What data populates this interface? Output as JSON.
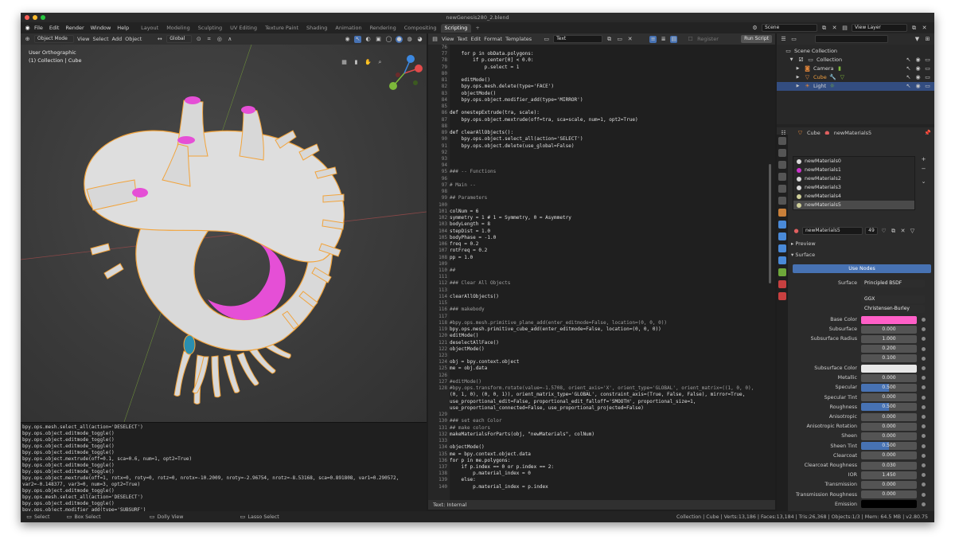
{
  "window_title": "newGenesis280_2.blend",
  "menu": [
    "File",
    "Edit",
    "Render",
    "Window",
    "Help"
  ],
  "workspaces": [
    "Layout",
    "Modeling",
    "Sculpting",
    "UV Editing",
    "Texture Paint",
    "Shading",
    "Animation",
    "Rendering",
    "Compositing",
    "Scripting",
    "+"
  ],
  "active_workspace": "Scripting",
  "scene": "Scene",
  "view_layer": "View Layer",
  "viewport_header": {
    "mode": "Object Mode",
    "items": [
      "View",
      "Select",
      "Add",
      "Object"
    ],
    "transform": "Global"
  },
  "viewport": {
    "label1": "User Orthographic",
    "label2": "(1) Collection | Cube"
  },
  "text_header": {
    "items": [
      "View",
      "Text",
      "Edit",
      "Format",
      "Templates"
    ],
    "datablock": "Text",
    "register": "Register",
    "run": "Run Script"
  },
  "code_lines": [
    {
      "n": "76",
      "t": ""
    },
    {
      "n": "77",
      "t": "    for p in obData.polygons:"
    },
    {
      "n": "78",
      "t": "        if p.center[0] < 0.0:"
    },
    {
      "n": "79",
      "t": "            p.select = 1"
    },
    {
      "n": "80",
      "t": ""
    },
    {
      "n": "81",
      "t": "    editMode()"
    },
    {
      "n": "82",
      "t": "    bpy.ops.mesh.delete(type='FACE')"
    },
    {
      "n": "83",
      "t": "    objectMode()"
    },
    {
      "n": "84",
      "t": "    bpy.ops.object.modifier_add(type='MIRROR')"
    },
    {
      "n": "85",
      "t": ""
    },
    {
      "n": "86",
      "t": "def onestepExtrude(tra, scale):"
    },
    {
      "n": "87",
      "t": "    bpy.ops.object.mextrude(off=tra, sca=scale, num=1, opt2=True)"
    },
    {
      "n": "88",
      "t": ""
    },
    {
      "n": "89",
      "t": "def clearAllObjects():"
    },
    {
      "n": "90",
      "t": "    bpy.ops.object.select_all(action='SELECT')"
    },
    {
      "n": "91",
      "t": "    bpy.ops.object.delete(use_global=False)"
    },
    {
      "n": "92",
      "t": ""
    },
    {
      "n": "93",
      "t": ""
    },
    {
      "n": "94",
      "t": ""
    },
    {
      "n": "95",
      "t": "### -- Functions"
    },
    {
      "n": "96",
      "t": ""
    },
    {
      "n": "97",
      "t": "# Main --"
    },
    {
      "n": "98",
      "t": ""
    },
    {
      "n": "99",
      "t": "## Parameters"
    },
    {
      "n": "100",
      "t": ""
    },
    {
      "n": "101",
      "t": "colNum = 6"
    },
    {
      "n": "102",
      "t": "symmetry = 1 # 1 = Symmetry, 0 = Asymmetry"
    },
    {
      "n": "103",
      "t": "bodyLength = 8"
    },
    {
      "n": "104",
      "t": "stepDist = 1.0"
    },
    {
      "n": "105",
      "t": "bodyPhase = -1.0"
    },
    {
      "n": "106",
      "t": "freq = 0.2"
    },
    {
      "n": "107",
      "t": "rotFreq = 0.2"
    },
    {
      "n": "108",
      "t": "pp = 1.0"
    },
    {
      "n": "109",
      "t": ""
    },
    {
      "n": "110",
      "t": "##"
    },
    {
      "n": "111",
      "t": ""
    },
    {
      "n": "112",
      "t": "### Clear All Objects"
    },
    {
      "n": "113",
      "t": ""
    },
    {
      "n": "114",
      "t": "clearAllObjects()"
    },
    {
      "n": "115",
      "t": ""
    },
    {
      "n": "116",
      "t": "### makebody"
    },
    {
      "n": "117",
      "t": ""
    },
    {
      "n": "118",
      "t": "#bpy.ops.mesh.primitive_plane_add(enter_editmode=False, location=(0, 0, 0))"
    },
    {
      "n": "119",
      "t": "bpy.ops.mesh.primitive_cube_add(enter_editmode=False, location=(0, 0, 0))"
    },
    {
      "n": "120",
      "t": "editMode()"
    },
    {
      "n": "121",
      "t": "deselectAllFace()"
    },
    {
      "n": "122",
      "t": "objectMode()"
    },
    {
      "n": "123",
      "t": ""
    },
    {
      "n": "124",
      "t": "obj = bpy.context.object"
    },
    {
      "n": "125",
      "t": "me = obj.data"
    },
    {
      "n": "126",
      "t": ""
    },
    {
      "n": "127",
      "t": "#editMode()"
    },
    {
      "n": "128",
      "t": "#bpy.ops.transform.rotate(value=-1.5708, orient_axis='X', orient_type='GLOBAL', orient_matrix=((1, 0, 0),"
    },
    {
      "n": "",
      "t": "(0, 1, 0), (0, 0, 1)), orient_matrix_type='GLOBAL', constraint_axis=(True, False, False), mirror=True,"
    },
    {
      "n": "",
      "t": "use_proportional_edit=False, proportional_edit_falloff='SMOOTH', proportional_size=1,"
    },
    {
      "n": "",
      "t": "use_proportional_connected=False, use_proportional_projected=False)"
    },
    {
      "n": "129",
      "t": ""
    },
    {
      "n": "130",
      "t": "### set each Color"
    },
    {
      "n": "131",
      "t": "## make colors"
    },
    {
      "n": "132",
      "t": "makeMaterialsForParts(obj, \"newMaterials\", colNum)"
    },
    {
      "n": "133",
      "t": ""
    },
    {
      "n": "134",
      "t": "objectMode()"
    },
    {
      "n": "135",
      "t": "me = bpy.context.object.data"
    },
    {
      "n": "136",
      "t": "for p in me.polygons:"
    },
    {
      "n": "137",
      "t": "    if p.index == 0 or p.index == 2:"
    },
    {
      "n": "138",
      "t": "        p.material_index = 0"
    },
    {
      "n": "139",
      "t": "    else:"
    },
    {
      "n": "140",
      "t": "        p.material_index = p.index"
    }
  ],
  "text_footer": "Text: Internal",
  "console_lines": [
    "bpy.ops.mesh.select_all(action='DESELECT')",
    "bpy.ops.object.editmode_toggle()",
    "bpy.ops.object.editmode_toggle()",
    "bpy.ops.object.editmode_toggle()",
    "bpy.ops.object.editmode_toggle()",
    "bpy.ops.object.mextrude(off=0.1, sca=0.6, num=1, opt2=True)",
    "bpy.ops.object.editmode_toggle()",
    "bpy.ops.object.editmode_toggle()",
    "bpy.ops.object.mextrude(off=1, rotx=0, roty=0, rotz=0, nrotx=-10.2009, nroty=-2.96754, nrotz=-8.53168, sca=0.891808, var1=0.290572,",
    "var2=-0.148377, var3=0, num=3, opt2=True)",
    "bpy.ops.object.editmode_toggle()",
    "bpy.ops.mesh.select_all(action='DESELECT')",
    "bpy.ops.object.editmode_toggle()",
    "bpy.ops.object.modifier_add(type='SUBSURF')",
    "bpy.ops.text.run_script()"
  ],
  "outliner": {
    "root": "Scene Collection",
    "collection": "Collection",
    "items": [
      "Camera",
      "Cube",
      "Light"
    ]
  },
  "props_header": {
    "object": "Cube",
    "material": "newMaterials5"
  },
  "materials": [
    {
      "name": "newMaterials0",
      "color": "#d8d8d8"
    },
    {
      "name": "newMaterials1",
      "color": "#cc33cc"
    },
    {
      "name": "newMaterials2",
      "color": "#d8d8d8"
    },
    {
      "name": "newMaterials3",
      "color": "#d8d8d8"
    },
    {
      "name": "newMaterials4",
      "color": "#cfcf99"
    },
    {
      "name": "newMaterials5",
      "color": "#cfcf99"
    }
  ],
  "material_slot": {
    "name": "newMaterials5",
    "users": "49"
  },
  "panels": {
    "preview": "Preview",
    "surface": "Surface",
    "use_nodes": "Use Nodes"
  },
  "surface": {
    "shader": "Principled BSDF",
    "distribution": "GGX",
    "subsurface_method": "Christensen-Burley"
  },
  "base_color": "#ff5fc8",
  "params": [
    {
      "label": "Base Color",
      "value": ""
    },
    {
      "label": "Subsurface",
      "value": "0.000"
    },
    {
      "label": "Subsurface Radius",
      "value": "1.000"
    },
    {
      "label": "",
      "value": "0.200"
    },
    {
      "label": "",
      "value": "0.100"
    },
    {
      "label": "Subsurface Color",
      "value": ""
    },
    {
      "label": "Metallic",
      "value": "0.000"
    },
    {
      "label": "Specular",
      "value": "0.500"
    },
    {
      "label": "Specular Tint",
      "value": "0.000"
    },
    {
      "label": "Roughness",
      "value": "0.500"
    },
    {
      "label": "Anisotropic",
      "value": "0.000"
    },
    {
      "label": "Anisotropic Rotation",
      "value": "0.000"
    },
    {
      "label": "Sheen",
      "value": "0.000"
    },
    {
      "label": "Sheen Tint",
      "value": "0.500"
    },
    {
      "label": "Clearcoat",
      "value": "0.000"
    },
    {
      "label": "Clearcoat Roughness",
      "value": "0.030"
    },
    {
      "label": "IOR",
      "value": "1.450"
    },
    {
      "label": "Transmission",
      "value": "0.000"
    },
    {
      "label": "Transmission Roughness",
      "value": "0.000"
    },
    {
      "label": "Emission",
      "value": ""
    }
  ],
  "status": {
    "select": "Select",
    "box_select": "Box Select",
    "dolly": "Dolly View",
    "lasso": "Lasso Select",
    "stats": "Collection | Cube | Verts:13,186 | Faces:13,184 | Tris:26,368 | Objects:1/3 | Mem: 64.5 MB | v2.80.75"
  }
}
